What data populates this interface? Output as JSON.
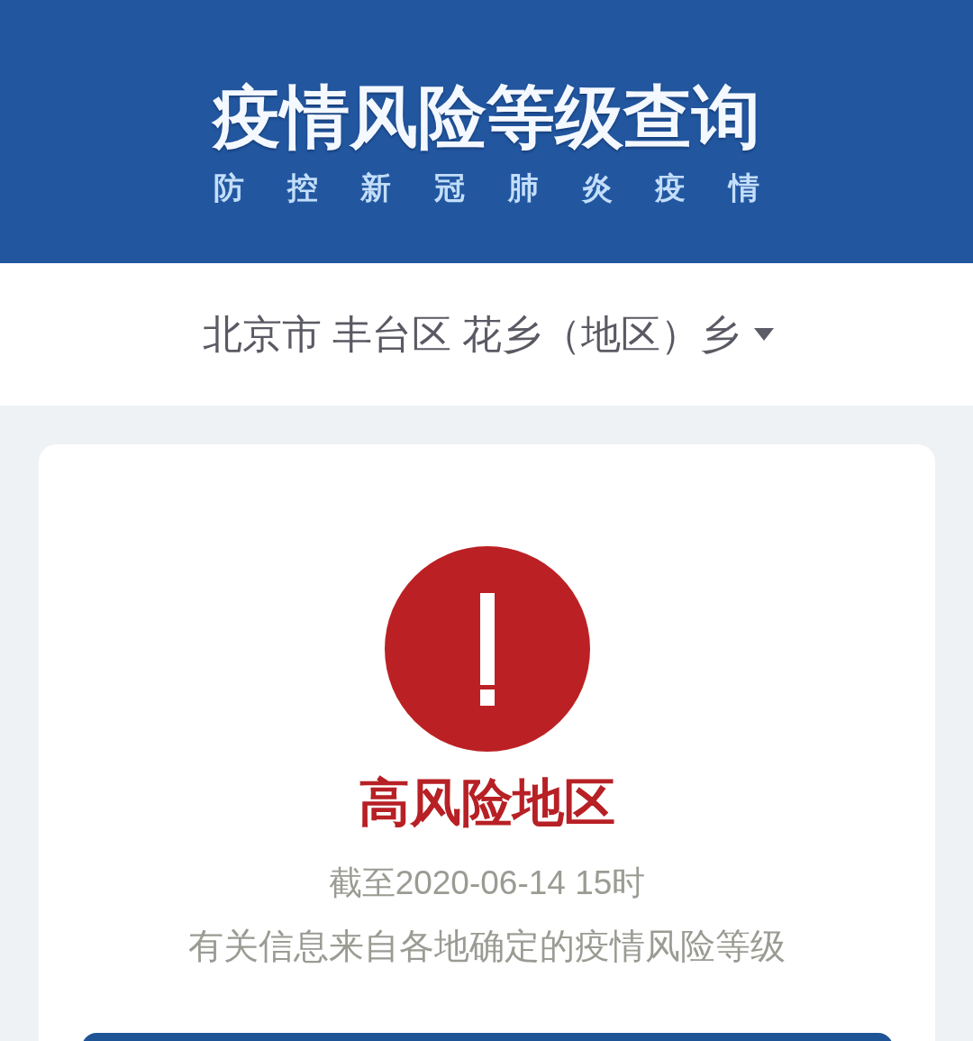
{
  "header": {
    "title": "疫情风险等级查询",
    "subtitle": "防 控 新 冠 肺 炎 疫 情"
  },
  "region_select": {
    "value": "北京市 丰台区 花乡（地区）乡"
  },
  "result": {
    "kind": "high",
    "label": "高风险地区",
    "as_of": "截至2020-06-14 15时",
    "note": "有关信息来自各地确定的疫情风险等级"
  }
}
